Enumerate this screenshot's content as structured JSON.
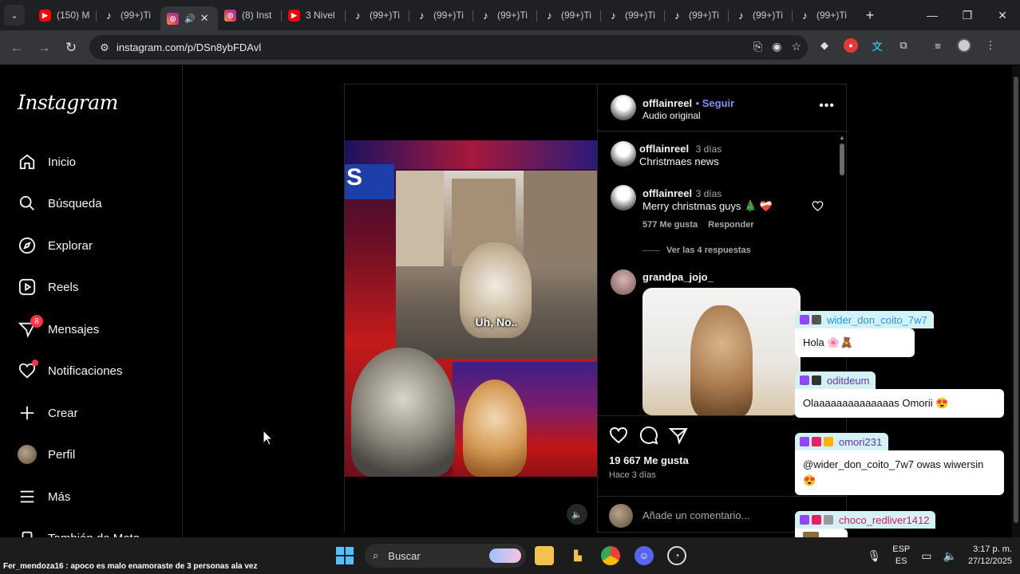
{
  "browser": {
    "tabs": [
      {
        "label": "(150) M",
        "favicon": "youtube-icon"
      },
      {
        "label": "(99+)Ti",
        "favicon": "tiktok-icon"
      },
      {
        "label": "",
        "favicon": "instagram-icon",
        "active": true
      },
      {
        "label": "(8) Inst",
        "favicon": "instagram-icon"
      },
      {
        "label": "3 Nivel",
        "favicon": "youtube-icon"
      },
      {
        "label": "(99+)Ti",
        "favicon": "tiktok-icon"
      },
      {
        "label": "(99+)Ti",
        "favicon": "tiktok-icon"
      },
      {
        "label": "(99+)Ti",
        "favicon": "tiktok-icon"
      },
      {
        "label": "(99+)Ti",
        "favicon": "tiktok-icon"
      },
      {
        "label": "(99+)Ti",
        "favicon": "tiktok-icon"
      },
      {
        "label": "(99+)Ti",
        "favicon": "tiktok-icon"
      },
      {
        "label": "(99+)Ti",
        "favicon": "tiktok-icon"
      },
      {
        "label": "(99+)Ti",
        "favicon": "tiktok-icon"
      }
    ],
    "url": "instagram.com/p/DSn8ybFDAvl"
  },
  "sidebar": {
    "logo": "Instagram",
    "items": [
      {
        "label": "Inicio",
        "icon": "home-icon"
      },
      {
        "label": "Búsqueda",
        "icon": "search-icon"
      },
      {
        "label": "Explorar",
        "icon": "compass-icon"
      },
      {
        "label": "Reels",
        "icon": "reels-icon"
      },
      {
        "label": "Mensajes",
        "icon": "messenger-icon",
        "badge": "8"
      },
      {
        "label": "Notificaciones",
        "icon": "heart-icon"
      },
      {
        "label": "Crear",
        "icon": "plus-icon"
      },
      {
        "label": "Perfil",
        "icon": "avatar"
      },
      {
        "label": "Más",
        "icon": "menu-icon"
      },
      {
        "label": "También de Meta",
        "icon": "meta-icon"
      }
    ]
  },
  "post": {
    "video_caption": "Uh, No..",
    "author": "offlainreel",
    "follow_label": "Seguir",
    "audio": "Audio original",
    "caption": {
      "user": "offlainreel",
      "time": "3 días",
      "text": "Christmaes news"
    },
    "comments": [
      {
        "user": "offlainreel",
        "time": "3 días",
        "text": "Merry christmas guys 🎄 ❤️‍🩹",
        "likes": "577 Me gusta",
        "reply": "Responder",
        "view_replies": "Ver las 4 respuestas"
      },
      {
        "user": "grandpa_jojo_",
        "text": ""
      }
    ],
    "likes": "19 667 Me gusta",
    "date": "Hace 3 días",
    "add_comment_placeholder": "Añade un comentario..."
  },
  "chat": [
    {
      "user": "wider_don_coito_7w7",
      "user_color": "#1e88e5",
      "text": "Hola"
    },
    {
      "user": "oditdeum",
      "user_color": "#5e35b1",
      "text": "Olaaaaaaaaaaaaaas Omorii"
    },
    {
      "user": "omori231",
      "user_color": "#5e35b1",
      "text": "@wider_don_coito_7w7 owas wiwersin"
    },
    {
      "user": "choco_redliver1412",
      "user_color": "#d81b60",
      "text": ""
    }
  ],
  "taskbar": {
    "notification": "Fer_mendoza16 : apoco es malo enamoraste de 3 personas ala vez",
    "search": "Buscar",
    "lang_top": "ESP",
    "lang_bottom": "ES",
    "time": "3:17 p. m.",
    "date": "27/12/2025"
  }
}
